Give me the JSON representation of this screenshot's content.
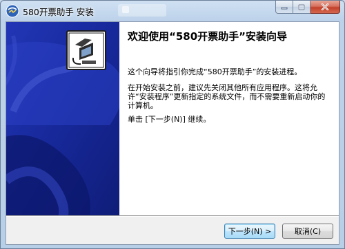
{
  "window": {
    "title": "580开票助手 安装"
  },
  "wizard": {
    "heading": "欢迎使用“580开票助手”安装向导",
    "paragraph1": "这个向导将指引你完成“580开票助手”的安装进程。",
    "paragraph2": "在开始安装之前，建议先关闭其他所有应用程序。这将允许“安装程序”更新指定的系统文件，而不需要重新启动你的计算机。",
    "paragraph3": "单击 [下一步(N)] 继续。"
  },
  "buttons": {
    "next": "下一步(N) >",
    "cancel": "取消(C)"
  },
  "colors": {
    "banner_blue": "#1b2fa8",
    "close_red": "#c2402a",
    "accent_blue": "#3c7fb1"
  }
}
